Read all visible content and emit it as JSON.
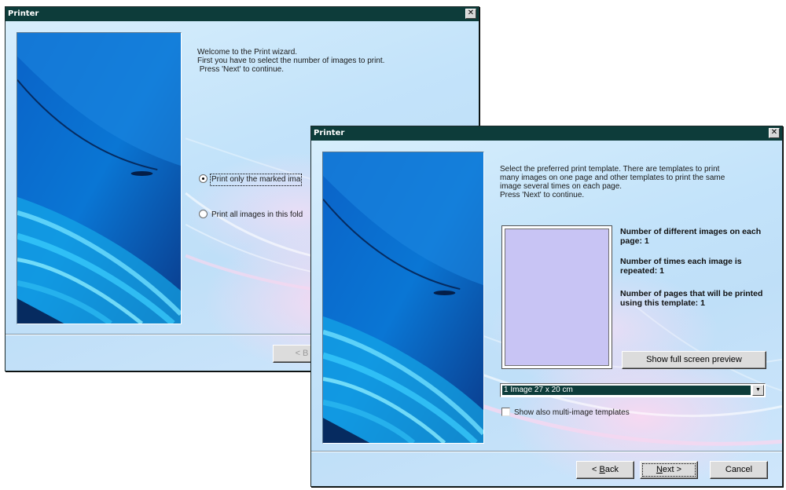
{
  "back_window": {
    "title": "Printer",
    "close_glyph": "✕",
    "intro_lines": [
      "Welcome to the Print wizard.",
      "First you have to select the number of images to print.",
      " Press 'Next' to continue."
    ],
    "radio_marked_label": "Print only the marked ima",
    "radio_all_label": "Print all images in this fold",
    "back_button_label": "< B"
  },
  "front_window": {
    "title": "Printer",
    "close_glyph": "✕",
    "intro_lines": [
      "Select the preferred print template. There are templates to print",
      "many images on one page and other templates to print the same",
      "image several times on each page.",
      "Press 'Next' to continue."
    ],
    "info_different": "Number of different images on each page: 1",
    "info_repeated": "Number of times each image is repeated: 1",
    "info_pages": "Number of pages that will be printed using this template: 1",
    "preview_button": "Show full screen preview",
    "template_select_value": "1 Image 27 x 20 cm",
    "multi_checkbox_label": "Show also multi-image templates",
    "back_button": {
      "prefix": "< ",
      "accel": "B",
      "rest": "ack"
    },
    "next_button": {
      "accel": "N",
      "rest": "ext >"
    },
    "cancel_button": "Cancel"
  },
  "colors": {
    "titlebar": "#0d3c3a",
    "client": "#bfdff8",
    "preview_fill": "#c8c4f4"
  }
}
